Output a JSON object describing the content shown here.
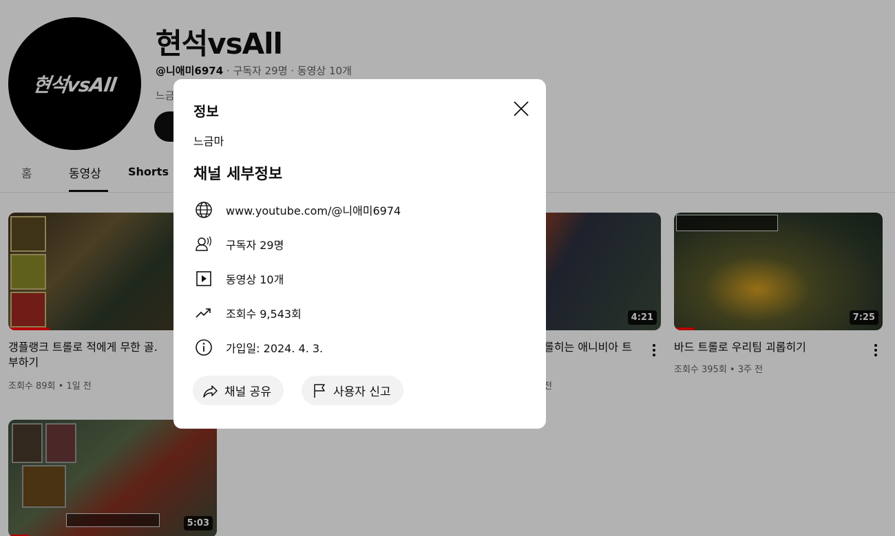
{
  "channel": {
    "avatar_text": "현석vsAll",
    "title": "현석vsAll",
    "handle": "@니애미6974",
    "meta_rest": " · 구독자 29명 · 동영상 10개",
    "desc_peek": "느금"
  },
  "tabs": [
    {
      "label": "홈"
    },
    {
      "label": "동영상"
    },
    {
      "label": "Shorts"
    }
  ],
  "videos": [
    {
      "title_line1": "갱플랭크 트롤로 적에게 무한 골.",
      "title_line2": "부하기",
      "meta": "조회수 89회 • 1일 전"
    },
    {
      "title": "롤히는 애니비아 트",
      "meta": "전",
      "duration": "4:21"
    },
    {
      "title": "바드 트롤로 우리팀 괴롭히기",
      "meta": "조회수 395회 • 3주 전",
      "duration": "7:25"
    },
    {
      "duration": "5:03"
    }
  ],
  "modal": {
    "title": "정보",
    "description": "느금마",
    "section_title": "채널 세부정보",
    "rows": [
      {
        "icon": "globe-icon",
        "text": "www.youtube.com/@니애미6974"
      },
      {
        "icon": "subscribers-icon",
        "text": "구독자 29명"
      },
      {
        "icon": "video-play-icon",
        "text": "동영상 10개"
      },
      {
        "icon": "trending-icon",
        "text": "조회수 9,543회"
      },
      {
        "icon": "info-icon",
        "text": "가입일: 2024. 4. 3."
      }
    ],
    "share_label": "채널 공유",
    "report_label": "사용자 신고"
  },
  "colors": {
    "scrim": "#b2b2b2",
    "modal_bg": "#ffffff",
    "pill_bg": "#f2f2f2",
    "progress": "#ff0000",
    "text": "#0f0f0f",
    "secondary_text": "#606060"
  }
}
